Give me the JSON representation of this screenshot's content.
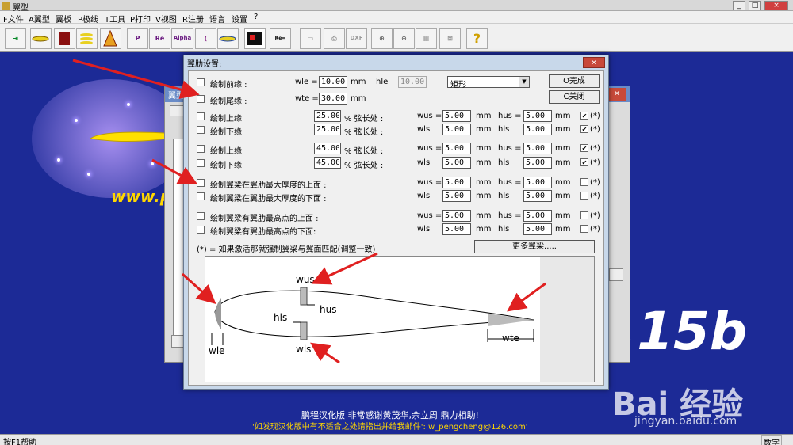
{
  "app": {
    "title": "翼型"
  },
  "menu": [
    "F文件",
    "A翼型",
    "翼板",
    "P极线",
    "T工具",
    "P打印",
    "V视图",
    "R注册",
    "语言",
    "设置",
    "?"
  ],
  "toolbar": {
    "buttons": [
      "exit",
      "airfoil",
      "book",
      "stack",
      "tower",
      "P",
      "Re",
      "Alpha",
      "arc",
      "wing",
      "chart",
      "calc",
      "print",
      "printer2",
      "DXF",
      "zoom-in",
      "zoom-out",
      "grid",
      "cross",
      "help"
    ]
  },
  "background": {
    "website": "www.pr",
    "version": ".15b",
    "credit1": "鹏程汉化版 非常感谢黄茂华,余立周 鼎力相助!",
    "credit2": "'如发现汉化版中有不适合之处请指出并给我邮件': w_pengcheng@126.com'",
    "bg_window_title": "翼型"
  },
  "status": {
    "help": "按F1帮助",
    "num": "数字"
  },
  "watermark": {
    "brand": "Bai 经验",
    "url": "jingyan.baidu.com"
  },
  "dialog": {
    "title": "翼肋设置:",
    "close": "×",
    "ok_label": "O完成",
    "cancel_label": "C关闭",
    "more_label": "更多翼梁.....",
    "leading": {
      "label": "绘制前缘 :",
      "wle_label": "wle =",
      "wle": "10.00",
      "unit": "mm",
      "hle_label": "hle",
      "hle": "10.00",
      "shape": "矩形"
    },
    "trailing": {
      "label": "绘制尾缘 :",
      "wte_label": "wte =",
      "wte": "30.00",
      "unit": "mm"
    },
    "pct_label": "% 弦长处 :",
    "mm": "mm",
    "forced": "(*)",
    "spars": [
      {
        "upper": "绘制上缘",
        "lower": "绘制下缘",
        "pct_u": "25.00",
        "pct_l": "25.00",
        "wus": "5.00",
        "wls": "5.00",
        "hus": "5.00",
        "hls": "5.00",
        "chk": true
      },
      {
        "upper": "绘制上缘",
        "lower": "绘制下缘",
        "pct_u": "45.00",
        "pct_l": "45.00",
        "wus": "5.00",
        "wls": "5.00",
        "hus": "5.00",
        "hls": "5.00",
        "chk": true
      },
      {
        "upper": "绘制翼梁在翼肋最大厚度的上面 :",
        "lower": "绘制翼梁在翼肋最大厚度的下面 :",
        "wus": "5.00",
        "wls": "5.00",
        "hus": "5.00",
        "hls": "5.00",
        "chk": false
      },
      {
        "upper": "绘制翼梁有翼肋最高点的上面 :",
        "lower": "绘制翼梁有翼肋最高点的下面:",
        "wus": "5.00",
        "wls": "5.00",
        "hus": "5.00",
        "hls": "5.00",
        "chk": false
      }
    ],
    "labels": {
      "wus": "wus =",
      "wls": "wls",
      "hus": "hus =",
      "hls": "hls"
    },
    "note": "(*) = 如果激活那就强制翼梁与翼面匹配(调整一致)",
    "diagram": {
      "wus": "wus",
      "hus": "hus",
      "hls": "hls",
      "wls": "wls",
      "wle": "wle",
      "wte": "wte"
    }
  },
  "colors": {
    "desktop": "#1c2a96",
    "arrow": "#e02020",
    "version": "#ffffff",
    "website": "#ffd700"
  }
}
